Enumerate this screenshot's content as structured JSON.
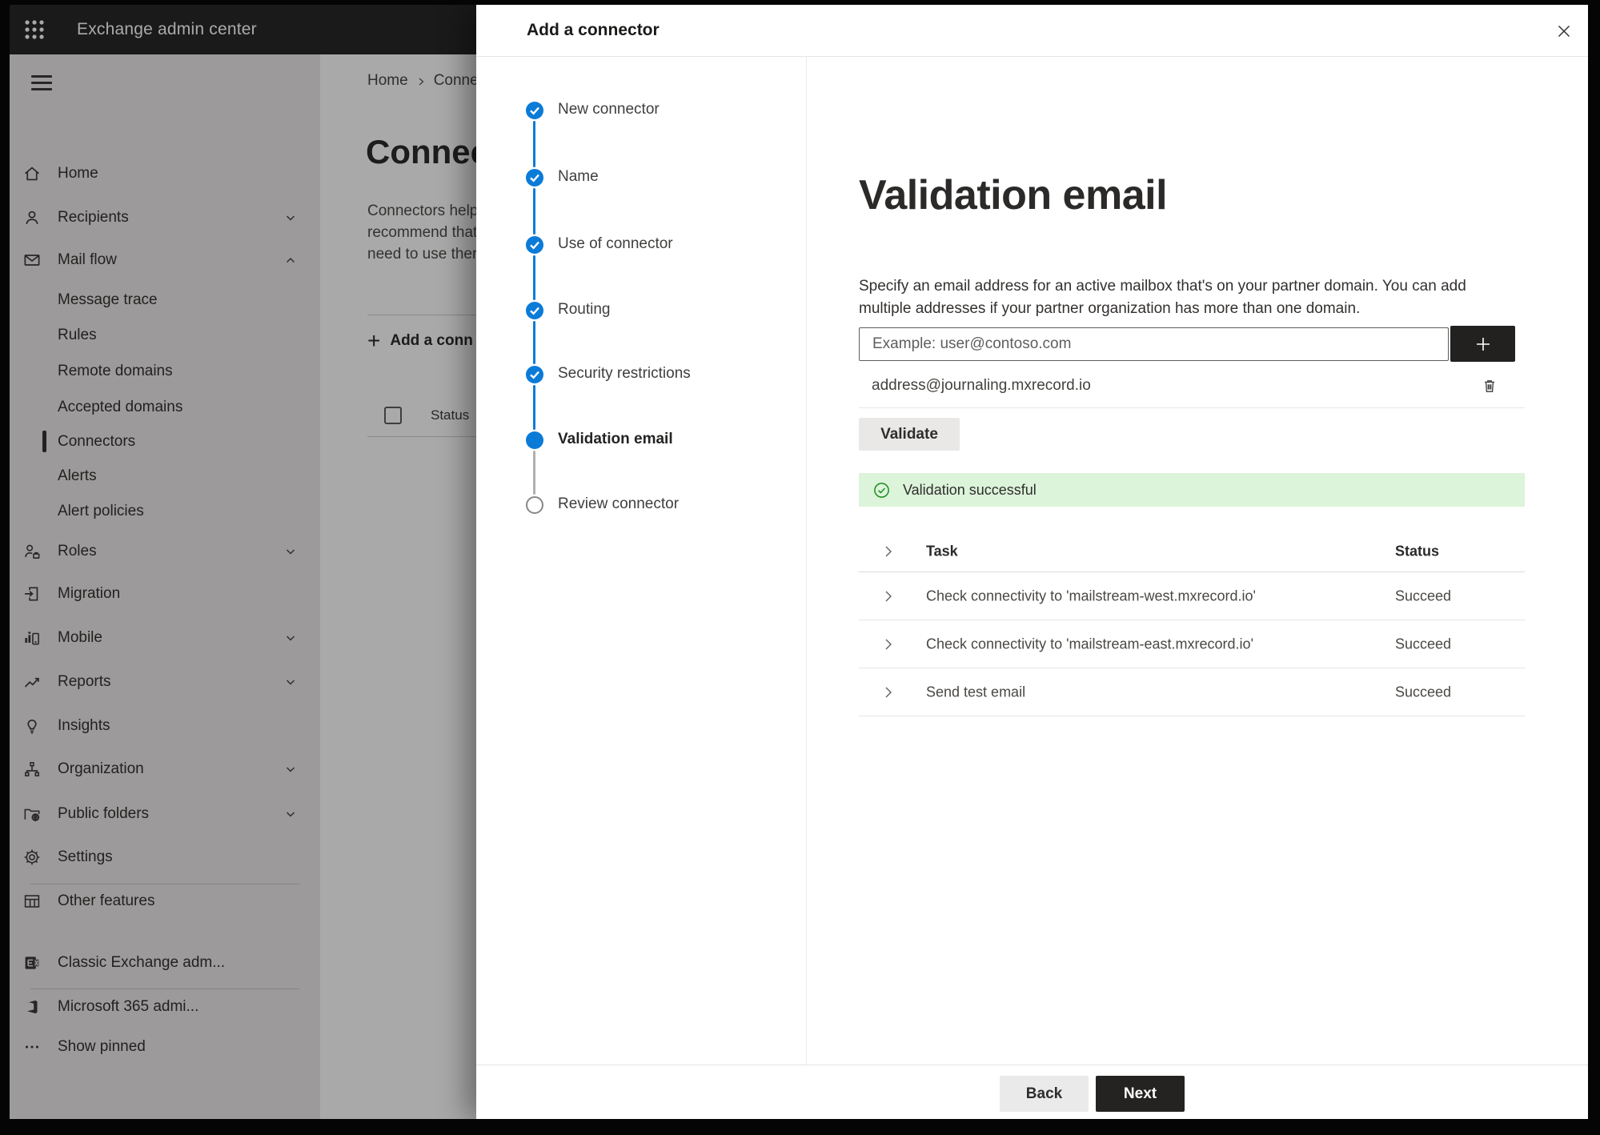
{
  "topbar": {
    "title": "Exchange admin center"
  },
  "sidebar": {
    "items": [
      {
        "label": "Home"
      },
      {
        "label": "Recipients"
      },
      {
        "label": "Mail flow"
      },
      {
        "label": "Message trace"
      },
      {
        "label": "Rules"
      },
      {
        "label": "Remote domains"
      },
      {
        "label": "Accepted domains"
      },
      {
        "label": "Connectors",
        "selected": true
      },
      {
        "label": "Alerts"
      },
      {
        "label": "Alert policies"
      },
      {
        "label": "Roles"
      },
      {
        "label": "Migration"
      },
      {
        "label": "Mobile"
      },
      {
        "label": "Reports"
      },
      {
        "label": "Insights"
      },
      {
        "label": "Organization"
      },
      {
        "label": "Public folders"
      },
      {
        "label": "Settings"
      },
      {
        "label": "Other features"
      },
      {
        "label": "Classic Exchange adm..."
      },
      {
        "label": "Microsoft 365 admi..."
      },
      {
        "label": "Show pinned"
      }
    ]
  },
  "page": {
    "breadcrumb": {
      "home": "Home",
      "current": "Conne"
    },
    "title": "Connec",
    "paragraph_lines": {
      "line1": "Connectors help",
      "line2": "recommend that",
      "line3": "need to use ther"
    },
    "add_button_label": "Add a conn",
    "list_header_status": "Status"
  },
  "dialog": {
    "title": "Add a connector",
    "steps": [
      {
        "label": "New connector",
        "state": "completed"
      },
      {
        "label": "Name",
        "state": "completed"
      },
      {
        "label": "Use of connector",
        "state": "completed"
      },
      {
        "label": "Routing",
        "state": "completed"
      },
      {
        "label": "Security restrictions",
        "state": "completed"
      },
      {
        "label": "Validation email",
        "state": "current"
      },
      {
        "label": "Review connector",
        "state": "upcoming"
      }
    ],
    "heading": "Validation email",
    "description": "Specify an email address for an active mailbox that's on your partner domain. You can add multiple addresses if your partner organization has more than one domain.",
    "email_input": {
      "placeholder": "Example: user@contoso.com",
      "value": ""
    },
    "addresses": [
      {
        "value": "address@journaling.mxrecord.io"
      }
    ],
    "validate_button": "Validate",
    "banner": {
      "text": "Validation successful"
    },
    "results": {
      "columns": {
        "task": "Task",
        "status": "Status"
      },
      "rows": [
        {
          "task": "Check connectivity to 'mailstream-west.mxrecord.io'",
          "status": "Succeed"
        },
        {
          "task": "Check connectivity to 'mailstream-east.mxrecord.io'",
          "status": "Succeed"
        },
        {
          "task": "Send test email",
          "status": "Succeed"
        }
      ]
    },
    "footer": {
      "back": "Back",
      "next": "Next"
    }
  },
  "colors": {
    "accent": "#0b7bd8",
    "success_banner_bg": "#dcf4da",
    "success_icon": "#1e8c1e",
    "topbar_bg": "#262626"
  }
}
